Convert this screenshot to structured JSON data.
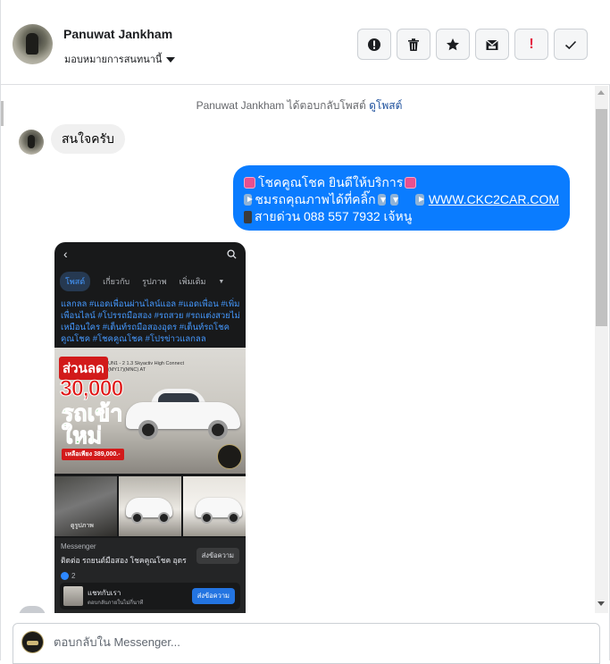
{
  "header": {
    "user_name": "Panuwat Jankham",
    "assign_label": "มอบหมายการสนทนานี้"
  },
  "actions": [
    {
      "name": "report-icon"
    },
    {
      "name": "trash-icon"
    },
    {
      "name": "star-icon"
    },
    {
      "name": "mark-unread-icon"
    },
    {
      "name": "spam-icon",
      "label": "!"
    },
    {
      "name": "done-check-icon"
    }
  ],
  "system_message": {
    "text": "Panuwat Jankham ได้ตอบกลับโพสต์",
    "link": "ดูโพสต์"
  },
  "messages": {
    "incoming_text": "สนใจครับ",
    "outgoing": {
      "line1": "โชคคูณโชค ยินดีให้บริการ",
      "line2": "ชมรถคุณภาพได้ที่คลิ๊ก",
      "link": "WWW.CKC2CAR.COM",
      "line3": "สายด่วน 088 557 7932 เจ้หนู"
    }
  },
  "shared_post": {
    "tabs": [
      "โพสต์",
      "เกี่ยวกับ",
      "รูปภาพ",
      "เพิ่มเติม"
    ],
    "hashtags": "แลกลล #แอดเพื่อนผ่านไลน์แอล #แอดเพื่อน #เพิ่มเพื่อนไลน์ #โปรรถมือสอง #รถสวย #รถแต่งสวยไม่เหมือนใคร #เต็นท์รถมือสองอุดร #เต็นท์รถโชคคูณโชค #โชคคูณโชค #โปรข่าวแลกลล",
    "sale_label": "ส่วนลด",
    "sale_amount": "30,000",
    "green_text": "รถเข้าใหม่",
    "price_pill": "เหลือเพียง 389,000.-",
    "spec_line1": "UN1 - 2 1.3 Skyactiv High Connect",
    "spec_line2": "(MY17)(MNC) AT",
    "thumb_badge": "ดูรูปภาพ",
    "messenger_label": "Messenger",
    "messenger_title": "ติดต่อ รถยนต์มือสอง โชคคูณโชค อุดร",
    "send_chip": "ส่งข้อความ",
    "likes_count": "2",
    "chat_title": "แชทกับเรา",
    "chat_sub": "ตอบกลับภายในไม่กี่นาที",
    "chat_button": "ส่งข้อความ"
  },
  "reply": {
    "placeholder": "ตอบกลับใน Messenger..."
  }
}
